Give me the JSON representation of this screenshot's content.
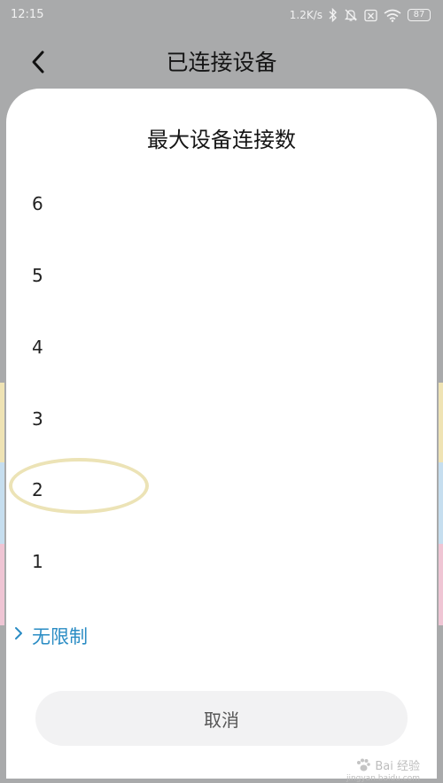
{
  "status_bar": {
    "time": "12:15",
    "speed": "1.2K/s",
    "battery": "87",
    "icons": [
      "bluetooth-icon",
      "mute-icon",
      "sim-off-icon",
      "wifi-icon",
      "battery-icon"
    ]
  },
  "nav": {
    "back_icon": "chevron-left-icon",
    "title": "已连接设备"
  },
  "sheet": {
    "title": "最大设备连接数",
    "options": [
      {
        "label": "6"
      },
      {
        "label": "5"
      },
      {
        "label": "4"
      },
      {
        "label": "3"
      },
      {
        "label": "2"
      },
      {
        "label": "1"
      },
      {
        "label": "无限制",
        "selected": true
      }
    ],
    "cancel_label": "取消"
  },
  "watermark": {
    "text": "Bai 经验",
    "subtext": "jingyan.baidu.com"
  },
  "colors": {
    "background": "#a9aaab",
    "sheet": "#ffffff",
    "accent": "#2a8cc4",
    "highlight_ring": "#ece3b6",
    "cancel_bg": "#f2f2f3"
  }
}
